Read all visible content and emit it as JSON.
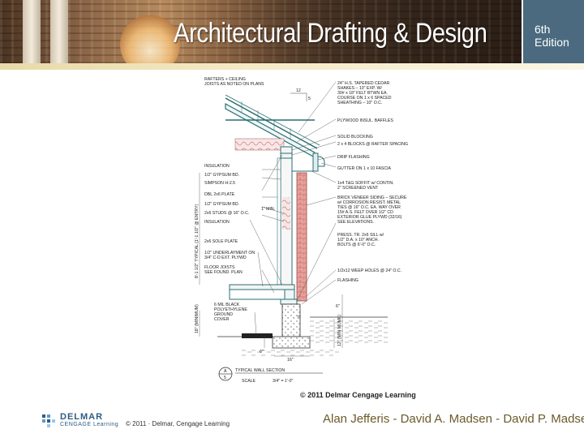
{
  "header": {
    "title": "Architectural Drafting & Design",
    "edition_number": "6th",
    "edition_word": "Edition"
  },
  "figure": {
    "labels_right": [
      "24\" H.S. TAPERED CEDAR",
      "SHAKES – 10\" EXP. W/",
      "30# x 18\" FELT BTWN EA.",
      "COURSE ON 1 x 6 SPACED",
      "SHEATHING – 10\" O.C.",
      "PLYWOOD INSUL. BAFFLES",
      "SOLID BLOCKING",
      "2 x 4 BLOCKS @ RAFTER SPACING",
      "DRIP FLASHING",
      "GUTTER ON 1 x 10 FASCIA",
      "1x4 T&G SOFFIT w/ CONTIN.",
      "2\" SCREENED VENT",
      "BRICK VENEER SIDING – SECURE",
      "w/ CORROSION RESIST. METAL",
      "TIES @ 16\" O.C. EA. WAY OVER",
      "15# A.S. FELT OVER 1/2\" CD",
      "EXTERIOR GLUE PLYWD (32/16)",
      "SEE ELEVATIONS.",
      "PRESS. TR. 2x6 SILL w/",
      "1/2\" D.A. x 10\" ANCH.",
      "BOLTS @ 6'-0\" O.C.",
      "1/2x12 WEEP HOLES @ 24\" O.C.",
      "FLASHING"
    ],
    "labels_left": [
      "RAFTERS + CEILING",
      "JOISTS AS NOTED ON PLANS",
      "INSULATION",
      "1/2\" GYPSUM BD.",
      "SIMPSON H-2.5",
      "DBL 2x6 PLATE",
      "1/2\" GYPSUM BD.",
      "2x6 STUDS @ 16\" O.C.",
      "INSULATION",
      "2x6 SOLE PLATE",
      "1/2\" UNDERLAYMENT ON",
      "3/4\" C-D EXT. PLYWD",
      "FLOOR JOISTS",
      "SEE FOUND. PLAN",
      "6 MIL BLACK",
      "POLYETHYLENE",
      "GROUND",
      "COVER"
    ],
    "dimensions": {
      "pitch_run": "12",
      "pitch_rise": "5",
      "wall_height": "8'-1 1/2\" TYPICAL (1'-1 1/2\" @ ENTRY)",
      "one_inch_min": "1\" MIN.",
      "crawl_min": "18\" (MINIMUM)",
      "footing_depth": "12\" (MIN MUMK)",
      "stem_height": "6\"",
      "footing_thick": "7\"",
      "footing_offset": "6\"",
      "footing_width": "16\""
    },
    "title_symbol_top": "A",
    "title_symbol_bottom": "5",
    "title": "TYPICAL WALL SECTION",
    "scale_label": "SCALE",
    "scale_value": "3/4\" = 1'-0\""
  },
  "copyright_line": "© 2011 Delmar Cengage Learning",
  "footer": {
    "logo_name": "DELMAR",
    "logo_sub": "CENGAGE Learning",
    "copyright": "© 2011 · Delmar, Cengage Learning",
    "authors": "Alan Jefferis - David A. Madsen - David P. Madsen"
  },
  "colors": {
    "edition_box": "#4b6a7f",
    "logo_blue": "#2f5c82",
    "authors_text": "#6b5a2a",
    "brick": "#d98a86"
  }
}
